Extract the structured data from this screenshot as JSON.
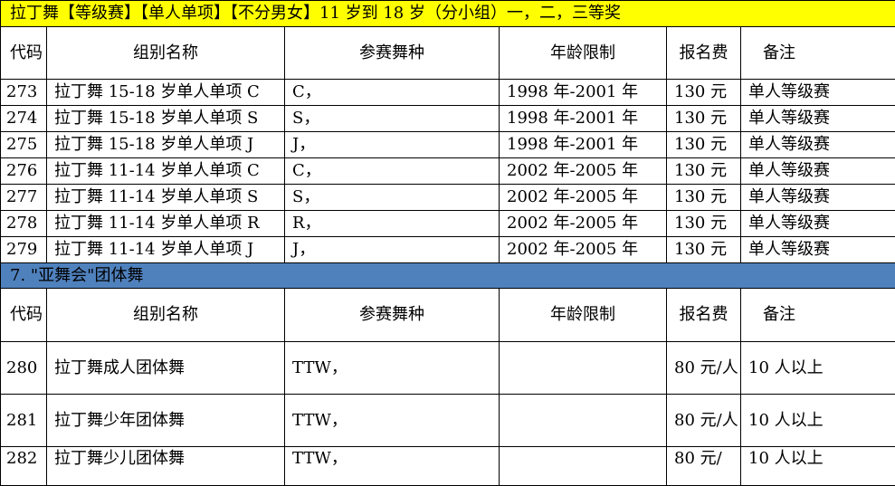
{
  "section1": {
    "title": "拉丁舞【等级赛】【单人单项】【不分男女】11 岁到 18 岁（分小组）一，二，三等奖"
  },
  "header": {
    "code": "代码",
    "group_name": "组别名称",
    "dance": "参赛舞种",
    "age_limit": "年龄限制",
    "fee": "报名费",
    "note": "备注"
  },
  "rows": [
    {
      "code": "273",
      "name": "拉丁舞 15-18 岁单人单项 C",
      "dance": "C，",
      "age": "1998 年-2001 年",
      "fee": "130 元",
      "note": "单人等级赛"
    },
    {
      "code": "274",
      "name": "拉丁舞 15-18 岁单人单项 S",
      "dance": "S，",
      "age": "1998 年-2001 年",
      "fee": "130 元",
      "note": "单人等级赛"
    },
    {
      "code": "275",
      "name": "拉丁舞 15-18 岁单人单项 J",
      "dance": "J，",
      "age": "1998 年-2001 年",
      "fee": "130 元",
      "note": "单人等级赛"
    },
    {
      "code": "276",
      "name": "拉丁舞 11-14 岁单人单项 C",
      "dance": "C，",
      "age": "2002 年-2005 年",
      "fee": "130 元",
      "note": "单人等级赛"
    },
    {
      "code": "277",
      "name": "拉丁舞 11-14 岁单人单项 S",
      "dance": "S，",
      "age": "2002 年-2005 年",
      "fee": "130 元",
      "note": "单人等级赛"
    },
    {
      "code": "278",
      "name": "拉丁舞 11-14 岁单人单项 R",
      "dance": "R，",
      "age": "2002 年-2005 年",
      "fee": "130 元",
      "note": "单人等级赛"
    },
    {
      "code": "279",
      "name": "拉丁舞 11-14 岁单人单项 J",
      "dance": "J，",
      "age": "2002 年-2005 年",
      "fee": "130 元",
      "note": "单人等级赛"
    }
  ],
  "section2": {
    "title": "7. \"亚舞会\"团体舞"
  },
  "team_rows": [
    {
      "code": "280",
      "name": "拉丁舞成人团体舞",
      "dance": "TTW，",
      "age": "",
      "fee": "80 元/人",
      "note": "10 人以上"
    },
    {
      "code": "281",
      "name": "拉丁舞少年团体舞",
      "dance": "TTW，",
      "age": "",
      "fee": "80 元/人",
      "note": "10 人以上"
    },
    {
      "code": "282",
      "name": "拉丁舞少儿团体舞",
      "dance": "TTW，",
      "age": "",
      "fee": "80 元/",
      "note": "10 人以上"
    }
  ]
}
